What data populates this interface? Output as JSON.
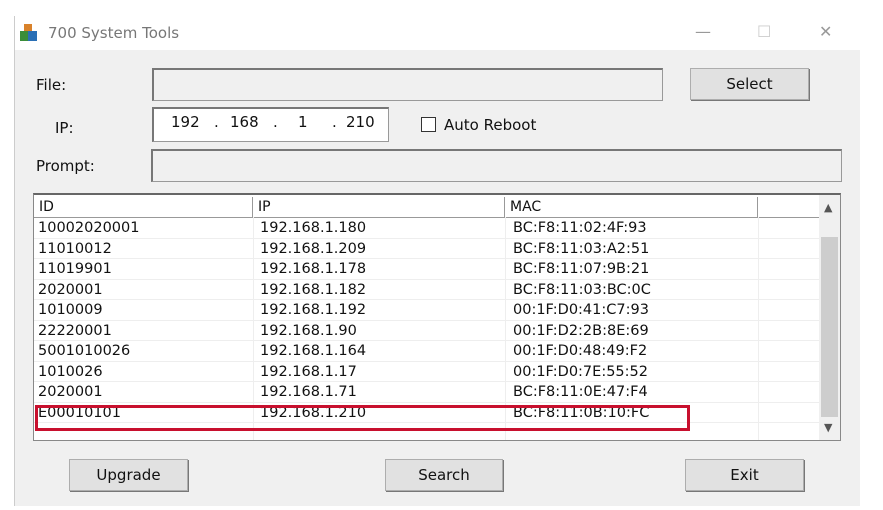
{
  "window": {
    "title": "700 System Tools",
    "minimize": "—",
    "maximize": "☐",
    "close": "✕"
  },
  "form": {
    "file_label": "File:",
    "file_value": "",
    "select_label": "Select",
    "ip_label": "IP:",
    "ip_octets": [
      "192",
      "168",
      "1",
      "210"
    ],
    "ip_sep": ".",
    "auto_reboot_label": "Auto Reboot",
    "auto_reboot_checked": false,
    "prompt_label": "Prompt:",
    "prompt_value": ""
  },
  "table": {
    "columns": [
      "ID",
      "IP",
      "MAC"
    ],
    "rows": [
      [
        "10002020001",
        "192.168.1.180",
        "BC:F8:11:02:4F:93"
      ],
      [
        "11010012",
        "192.168.1.209",
        "BC:F8:11:03:A2:51"
      ],
      [
        "11019901",
        "192.168.1.178",
        "BC:F8:11:07:9B:21"
      ],
      [
        "2020001",
        "192.168.1.182",
        "BC:F8:11:03:BC:0C"
      ],
      [
        "1010009",
        "192.168.1.192",
        "00:1F:D0:41:C7:93"
      ],
      [
        "22220001",
        "192.168.1.90",
        "00:1F:D2:2B:8E:69"
      ],
      [
        "5001010026",
        "192.168.1.164",
        "00:1F:D0:48:49:F2"
      ],
      [
        "1010026",
        "192.168.1.17",
        "00:1F:D0:7E:55:52"
      ],
      [
        "2020001",
        "192.168.1.71",
        "BC:F8:11:0E:47:F4"
      ],
      [
        "E00010101",
        "192.168.1.210",
        "BC:F8:11:0B:10:FC"
      ]
    ],
    "highlighted_row": 9,
    "highlight_color": "#c8102e"
  },
  "buttons": {
    "upgrade": "Upgrade",
    "search": "Search",
    "exit": "Exit"
  }
}
